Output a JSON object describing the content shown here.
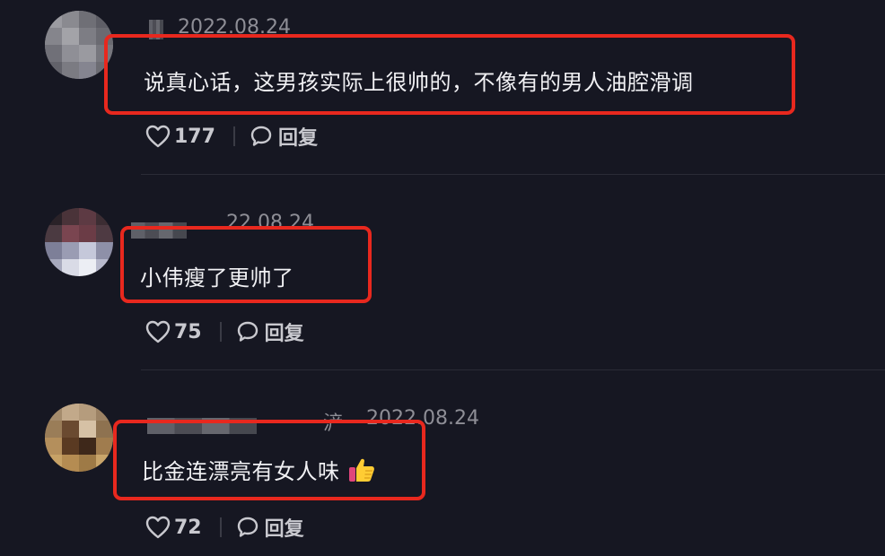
{
  "comments": [
    {
      "date": "2022.08.24",
      "text": "说真心话，这男孩实际上很帅的，不像有的男人油腔滑调",
      "likes": "177",
      "reply_label": "回复"
    },
    {
      "date": "22.08.24",
      "text": "小伟瘦了更帅了",
      "likes": "75",
      "reply_label": "回复"
    },
    {
      "date": "2022.08.24",
      "name_fragment": "浐",
      "text": "比金连漂亮有女人味",
      "emoji": "thumbs-up",
      "likes": "72",
      "reply_label": "回复"
    }
  ],
  "colors": {
    "background": "#161722",
    "highlight": "#e8281e",
    "text": "#f1f1f4",
    "meta": "#8e8e96"
  }
}
